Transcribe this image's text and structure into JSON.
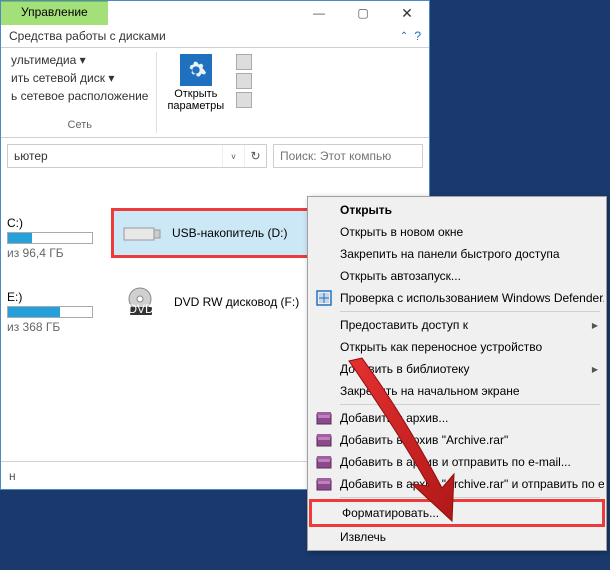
{
  "tabs": {
    "management": "Управление"
  },
  "ribbon": {
    "tab_label": "Средства работы с дисками",
    "net_items": {
      "multimedia": "ультимедиа ▾",
      "map_drive": "ить сетевой диск ▾",
      "net_location": "ь сетевое расположение"
    },
    "net_group": "Сеть",
    "open_params": "Открыть\nпараметры"
  },
  "address": {
    "text": "ьютер",
    "search_placeholder": "Поиск: Этот компью"
  },
  "drives": {
    "c": {
      "label": "C:)",
      "free": "из 96,4 ГБ",
      "fill_pct": 28
    },
    "e": {
      "label": "E:)",
      "free": "из 368 ГБ",
      "fill_pct": 62
    },
    "usb": {
      "label": "USB-накопитель (D:)"
    },
    "dvd": {
      "label": "DVD RW дисковод (F:)"
    }
  },
  "statusbar": "н",
  "ctx": {
    "open": "Открыть",
    "open_new": "Открыть в новом окне",
    "pin_quick": "Закрепить на панели быстрого доступа",
    "autoplay": "Открыть автозапуск...",
    "defender": "Проверка с использованием Windows Defender..",
    "share_to": "Предоставить доступ к",
    "open_portable": "Открыть как переносное устройство",
    "add_library": "Добавить в библиотеку",
    "pin_start": "Закрепить на начальном экране",
    "add_archive": "Добавить в архив...",
    "add_archive_rar": "Добавить в архив \"Archive.rar\"",
    "add_send_email": "Добавить в архив и отправить по e-mail...",
    "add_rar_send": "Добавить в архив \"Archive.rar\" и отправить по e-m",
    "format": "Форматировать...",
    "eject": "Извлечь"
  }
}
